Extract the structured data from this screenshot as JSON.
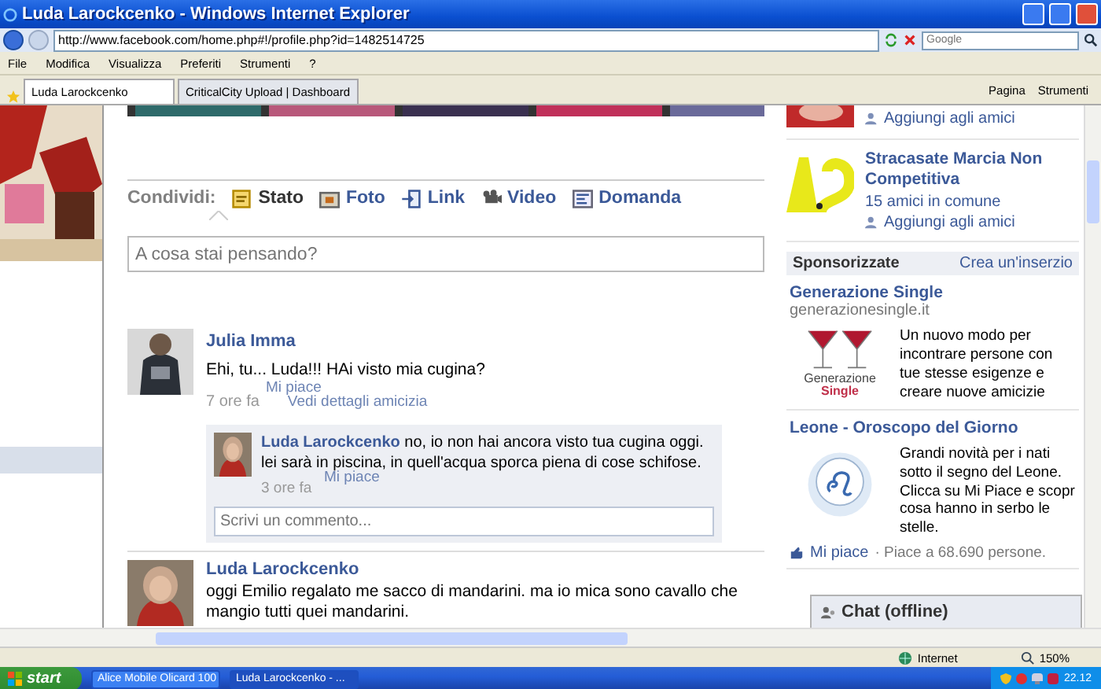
{
  "window": {
    "title": "Luda Larockcenko - Windows Internet Explorer"
  },
  "address_bar": {
    "url": "http://www.facebook.com/home.php#!/profile.php?id=1482514725"
  },
  "search": {
    "placeholder": "Google"
  },
  "menu": [
    "File",
    "Modifica",
    "Visualizza",
    "Preferiti",
    "Strumenti",
    "?"
  ],
  "tabs": [
    {
      "label": "Luda Larockcenko",
      "selected": true
    },
    {
      "label": "CriticalCity Upload | Dashboard",
      "selected": false
    }
  ],
  "toolbar": [
    "Pagina",
    "Strumenti"
  ],
  "share": {
    "label": "Condividi:",
    "options": [
      {
        "label": "Stato",
        "selected": true
      },
      {
        "label": "Foto",
        "selected": false
      },
      {
        "label": "Link",
        "selected": false
      },
      {
        "label": "Video",
        "selected": false
      },
      {
        "label": "Domanda",
        "selected": false
      }
    ],
    "placeholder": "A cosa stai pensando?"
  },
  "posts": [
    {
      "author": "Julia Imma",
      "text": "Ehi, tu... Luda!!! HAi visto mia cugina?",
      "time": "7 ore fa",
      "like": "Mi piace",
      "extra": "Vedi dettagli amicizia",
      "comments": [
        {
          "author": "Luda Larockcenko",
          "text": "no, io non hai ancora visto tua cugina oggi. lei sarà in piscina, in quell'acqua sporca piena di cose schifose.",
          "time": "3 ore fa",
          "like": "Mi piace"
        }
      ],
      "comment_placeholder": "Scrivi un commento..."
    },
    {
      "author": "Luda Larockcenko",
      "text": "oggi Emilio regalato me sacco di mandarini. ma io mica sono cavallo che mangio tutti quei mandarini."
    }
  ],
  "suggestions": [
    {
      "add": "Aggiungi agli amici"
    },
    {
      "name": "Stracasate Marcia Non Competitiva",
      "mutual": "15 amici in comune",
      "add": "Aggiungi agli amici"
    }
  ],
  "sponsored": {
    "title": "Sponsorizzate",
    "create": "Crea un'inserzio",
    "ads": [
      {
        "kind": "wine",
        "title": "Generazione Single",
        "domain": "generazionesingle.it",
        "logo": [
          "Generazione",
          "Single"
        ],
        "lines": [
          "Un nuovo modo per",
          "incontrare persone con",
          "tue stesse esigenze e",
          "creare nuove amicizie"
        ]
      },
      {
        "kind": "zodiac",
        "title": "Leone - Oroscopo del Giorno",
        "lines": [
          "Grandi novità per i nati",
          "sotto il segno del Leone.",
          "Clicca su Mi Piace e scopr",
          "cosa hanno in serbo le",
          "stelle."
        ],
        "like": "Mi piace",
        "likes": "· Piace a 68.690 persone."
      }
    ]
  },
  "chat": {
    "label": "Chat (offline)"
  },
  "status_bar": {
    "zone": "Internet",
    "zoom": "150%"
  },
  "taskbar": {
    "start": "start",
    "items": [
      {
        "label": "Alice Mobile Olicard 100",
        "selected": false
      },
      {
        "label": "Luda Larockcenko - ...",
        "selected": true
      }
    ],
    "clock": "22.12"
  }
}
